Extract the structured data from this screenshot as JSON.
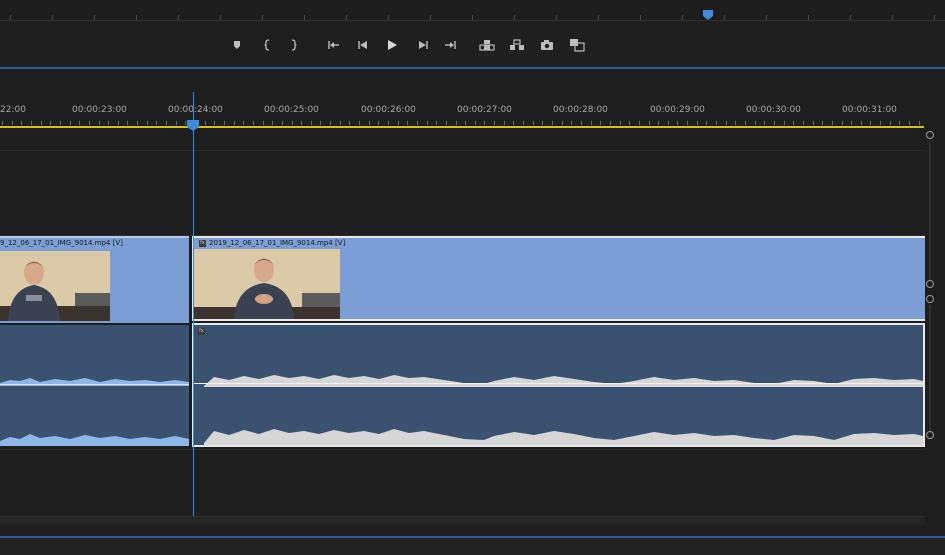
{
  "timeline": {
    "timecodes": [
      "22:00",
      "00:00:23:00",
      "00:00:24:00",
      "00:00:25:00",
      "00:00:26:00",
      "00:00:27:00",
      "00:00:28:00",
      "00:00:29:00",
      "00:00:30:00",
      "00:00:31:00"
    ]
  },
  "transport": {
    "buttons": [
      {
        "name": "add-marker-button",
        "icon": "marker-icon"
      },
      {
        "name": "mark-in-button",
        "icon": "mark-in-icon"
      },
      {
        "name": "mark-out-button",
        "icon": "mark-out-icon"
      },
      {
        "name": "go-to-in-button",
        "icon": "go-to-in-icon"
      },
      {
        "name": "step-back-button",
        "icon": "step-back-icon"
      },
      {
        "name": "play-button",
        "icon": "play-icon"
      },
      {
        "name": "step-forward-button",
        "icon": "step-forward-icon"
      },
      {
        "name": "go-to-out-button",
        "icon": "go-to-out-icon"
      },
      {
        "name": "lift-button",
        "icon": "lift-icon"
      },
      {
        "name": "extract-button",
        "icon": "extract-icon"
      },
      {
        "name": "export-frame-button",
        "icon": "camera-icon"
      },
      {
        "name": "comparison-view-button",
        "icon": "comparison-icon"
      }
    ]
  },
  "clips": {
    "video_left": {
      "label": "9_12_06_17_01_IMG_9014.mp4 [V]"
    },
    "video_right": {
      "label": "2019_12_06_17_01_IMG_9014.mp4 [V]",
      "fx": "fx"
    },
    "audio_right": {
      "fx": "fx"
    }
  },
  "colors": {
    "video_clip": "#7b9fd4",
    "audio_clip": "#3b5170",
    "playhead": "#3d8bd9",
    "work_area_bar": "#d4c21e"
  }
}
